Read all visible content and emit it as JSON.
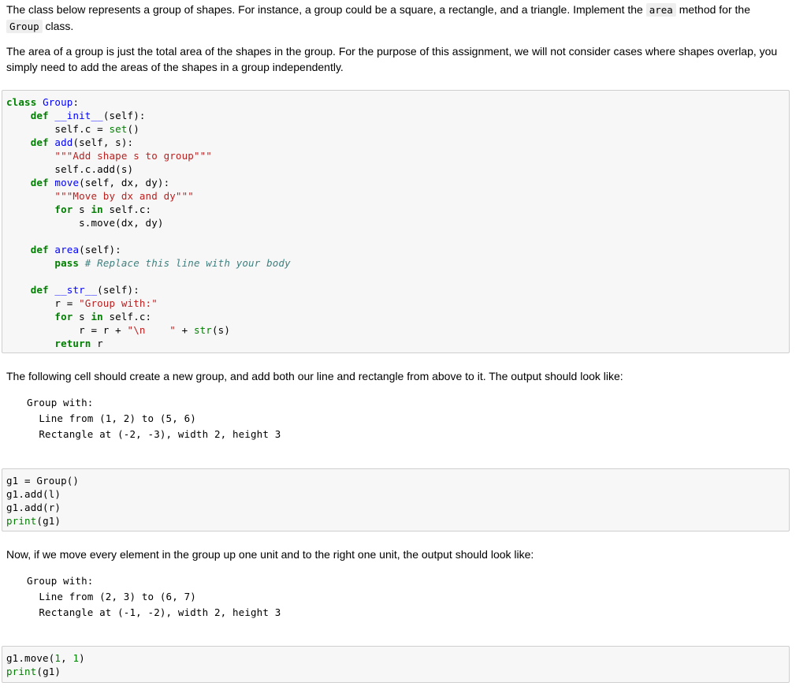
{
  "intro": {
    "text1": "The class below represents a group of shapes. For instance, a group could be a square, a rectangle, and a triangle. Implement the ",
    "code1": "area",
    "text2": " method for the",
    "code2": "Group",
    "text3": " class."
  },
  "para2": "The area of a group is just the total area of the shapes in the group. For the purpose of this assignment, we will not consider cases where shapes overlap, you simply need to add the areas of the shapes in a group independently.",
  "code_cell_1": {
    "lines": [
      "class Group:",
      "    def __init__(self):",
      "        self.c = set()",
      "    def add(self, s):",
      "        \"\"\"Add shape s to group\"\"\"",
      "        self.c.add(s)",
      "    def move(self, dx, dy):",
      "        \"\"\"Move by dx and dy\"\"\"",
      "        for s in self.c:",
      "            s.move(dx, dy)",
      "",
      "    def area(self):",
      "        pass # Replace this line with your body",
      "",
      "    def __str__(self):",
      "        r = \"Group with:\"",
      "        for s in self.c:",
      "            r = r + \"\\n    \" + str(s)",
      "        return r"
    ]
  },
  "para3": "The following cell should create a new group, and add both our line and rectangle from above to it. The output should look like:",
  "output_1": {
    "line1": "Group with:",
    "line2": "  Line from (1, 2) to (5, 6)",
    "line3": "  Rectangle at (-2, -3), width 2, height 3"
  },
  "code_cell_2": {
    "lines": [
      "g1 = Group()",
      "g1.add(l)",
      "g1.add(r)",
      "print(g1)"
    ]
  },
  "para4": "Now, if we move every element in the group up one unit and to the right one unit, the output should look like:",
  "output_2": {
    "line1": "Group with:",
    "line2": "  Line from (2, 3) to (6, 7)",
    "line3": "  Rectangle at (-1, -2), width 2, height 3"
  },
  "code_cell_3": {
    "lines": [
      "g1.move(1, 1)",
      "print(g1)"
    ]
  }
}
